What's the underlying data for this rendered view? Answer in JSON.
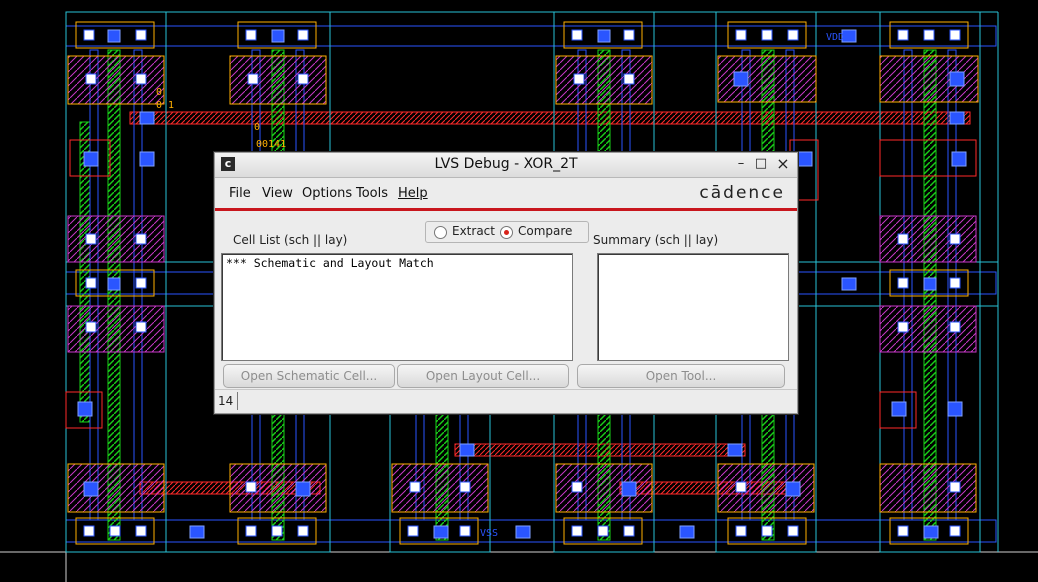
{
  "window": {
    "title": "LVS Debug - XOR_2T",
    "icon_letter": "c"
  },
  "window_controls": {
    "minimize": "–",
    "maximize": "□",
    "close": "×"
  },
  "menu": {
    "items": [
      "File",
      "View",
      "Options",
      "Tools",
      "Help"
    ]
  },
  "brand": "cādence",
  "mode": {
    "options": [
      "Extract",
      "Compare"
    ],
    "selected": "Compare"
  },
  "cell_list": {
    "label": "Cell List (sch || lay)",
    "lines": [
      "*** Schematic and Layout Match"
    ]
  },
  "summary": {
    "label": "Summary (sch || lay)",
    "lines": []
  },
  "buttons": {
    "open_schematic": "Open Schematic Cell...",
    "open_layout": "Open Layout Cell...",
    "open_tool": "Open Tool..."
  },
  "status": {
    "count": "14"
  },
  "layout_labels": {
    "net_a": "0",
    "net_b": "0 1",
    "net_c": "0",
    "net_d": "00141",
    "vdd": "VDD",
    "vss": "VSS"
  },
  "colors": {
    "poly": "#ff2a2a",
    "metal1": "#2a55ff",
    "metal2": "#19d019",
    "nwell": "#ffb000",
    "pwell": "#c838c8",
    "boundary": "#29c2d6",
    "accent_red": "#c8161d",
    "radio_dot": "#d8231a"
  }
}
